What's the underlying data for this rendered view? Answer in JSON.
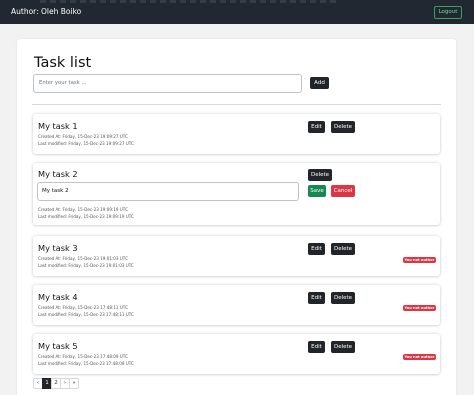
{
  "navbar": {
    "brand": "Author: Oleh Boiko",
    "logout": "Logout"
  },
  "page": {
    "title": "Task list",
    "input_placeholder": "Enter your task ...",
    "add_label": "Add"
  },
  "buttons": {
    "edit": "Edit",
    "delete": "Delete",
    "save": "Save",
    "cancel": "Cancel"
  },
  "badge": "You not author",
  "tasks": [
    {
      "title": "My task 1",
      "created": "Created At: Friday, 15-Dec-23 19:09:27 UTC",
      "modified": "Last modified: Friday, 15-Dec-23 19:09:27 UTC",
      "editing": false,
      "not_author": false
    },
    {
      "title": "My task 2",
      "edit_value": "My task 2",
      "created": "Created At: Friday, 15-Dec-23 19:09:19 UTC",
      "modified": "Last modified: Friday, 15-Dec-23 19:09:19 UTC",
      "editing": true,
      "not_author": false
    },
    {
      "title": "My task 3",
      "created": "Created At: Friday, 15-Dec-23 19:01:03 UTC",
      "modified": "Last modified: Friday, 15-Dec-23 19:01:03 UTC",
      "editing": false,
      "not_author": true
    },
    {
      "title": "My task 4",
      "created": "Created At: Friday, 15-Dec-23 17:48:11 UTC",
      "modified": "Last modified: Friday, 15-Dec-23 17:48:11 UTC",
      "editing": false,
      "not_author": true
    },
    {
      "title": "My task 5",
      "created": "Created At: Friday, 15-Dec-23 17:48:09 UTC",
      "modified": "Last modified: Friday, 15-Dec-23 17:48:09 UTC",
      "editing": false,
      "not_author": true
    }
  ],
  "pagination": {
    "prev": "‹",
    "pages": [
      "1",
      "2"
    ],
    "next": "›",
    "last": "»",
    "current": "1"
  },
  "colors": {
    "navbar": "#222831",
    "dark_button": "#212529",
    "save": "#198754",
    "danger": "#dc3545",
    "logout_border": "#3aa05a"
  }
}
